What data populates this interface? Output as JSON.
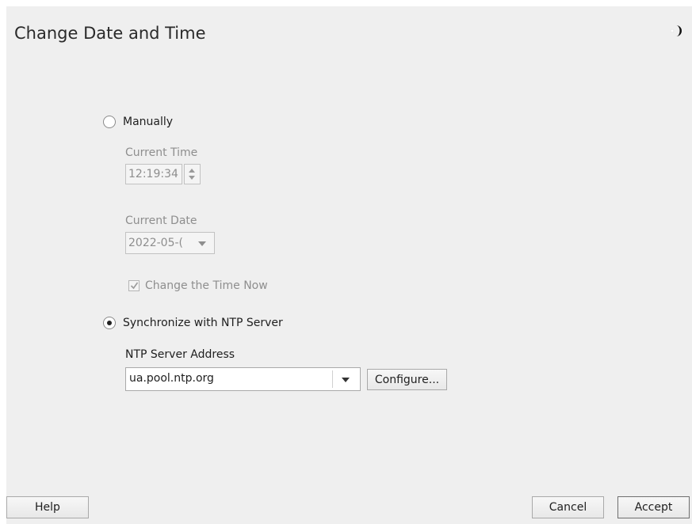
{
  "window": {
    "title": "Change Date and Time",
    "theme_icon": "moon-icon"
  },
  "manual": {
    "radio_label": "Manually",
    "selected": false,
    "current_time_label": "Current Time",
    "current_time_value": "12:19:34",
    "current_date_label": "Current Date",
    "current_date_value": "2022-05-(",
    "change_now_label": "Change the Time Now",
    "change_now_checked": true
  },
  "ntp": {
    "radio_label": "Synchronize with NTP Server",
    "selected": true,
    "address_label": "NTP Server Address",
    "address_value": "ua.pool.ntp.org",
    "configure_label": "Configure..."
  },
  "footer": {
    "help_label": "Help",
    "cancel_label": "Cancel",
    "accept_label": "Accept"
  },
  "colors": {
    "background": "#efefef",
    "disabled_text": "#8e8e8e",
    "text": "#1e1e1e"
  }
}
